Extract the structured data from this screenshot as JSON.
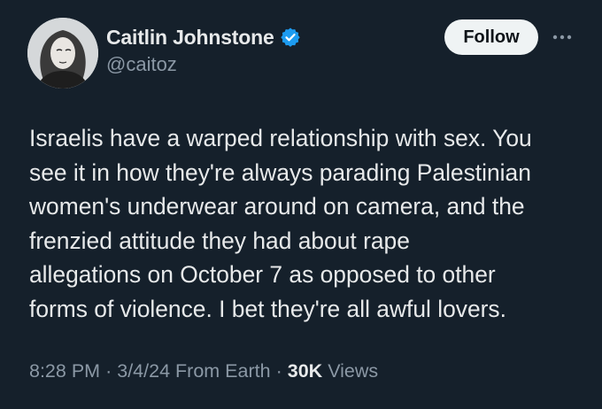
{
  "author": {
    "display_name": "Caitlin Johnstone",
    "handle": "@caitoz",
    "verified": true,
    "avatar": "profile-photo"
  },
  "header": {
    "follow_label": "Follow",
    "more_icon": "more-horizontal-icon"
  },
  "tweet": {
    "lines": [
      "Israelis have a warped relationship with sex. You",
      "see it in how they're always parading Palestinian",
      "women's underwear around on camera, and the",
      "frenzied attitude they had about rape",
      "allegations on October 7 as opposed to other",
      "forms of violence. I bet they're all awful lovers."
    ]
  },
  "meta": {
    "time": "8:28 PM",
    "separator": "·",
    "date": "3/4/24",
    "source": "From Earth",
    "views_count": "30K",
    "views_label": "Views"
  },
  "colors": {
    "background": "#15202b",
    "text_primary": "#e7e9ea",
    "text_secondary": "#8b98a5",
    "verified_badge": "#1d9bf0",
    "follow_button_bg": "#eff3f4"
  }
}
